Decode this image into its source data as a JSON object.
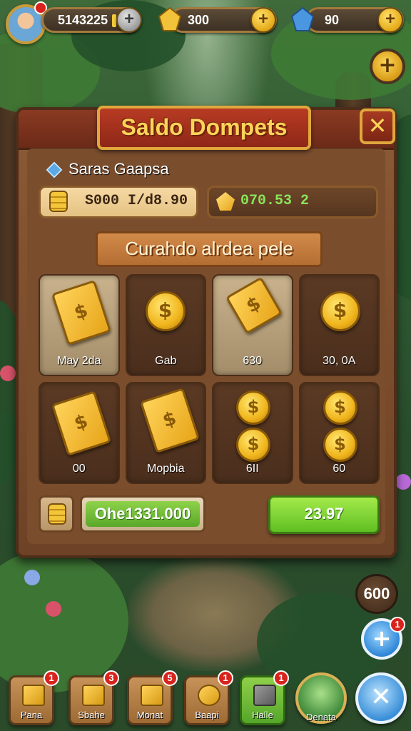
{
  "hud": {
    "player_currency": "5143225",
    "gold_gems": "300",
    "blue_gems": "90",
    "avatar_badge": "1"
  },
  "panel": {
    "title": "Saldo Dompets",
    "close_label": "✕",
    "section_title": "Saras Gaapsa",
    "coin_balance": "S000 I/d8.90",
    "gem_balance": "070.53 2",
    "sub_title": "Curahdo alrdea pele",
    "items": [
      {
        "label": "May 2da",
        "icon": "bill-icon"
      },
      {
        "label": "Gab",
        "icon": "coin-icon"
      },
      {
        "label": "630",
        "icon": "bill-icon"
      },
      {
        "label": "30, 0A",
        "icon": "coin-icon"
      },
      {
        "label": "00",
        "icon": "bill-icon"
      },
      {
        "label": "Mopbia",
        "icon": "bill-icon"
      },
      {
        "label": "6II",
        "icon": "coins-icon"
      },
      {
        "label": "60",
        "icon": "coins-icon"
      }
    ],
    "total": "Ohe1331.000",
    "buy_label": "23.97"
  },
  "side": {
    "counter": "600",
    "plus_badge": "1"
  },
  "nav": {
    "items": [
      {
        "label": "Pana",
        "badge": "1"
      },
      {
        "label": "Sbahe",
        "badge": "3"
      },
      {
        "label": "Monat",
        "badge": "5"
      },
      {
        "label": "Baapi",
        "badge": "1"
      },
      {
        "label": "Halle",
        "badge": "1"
      },
      {
        "label": "Denata"
      }
    ]
  },
  "colors": {
    "accent_gold": "#f0b51c",
    "panel_brown": "#7a4d2d",
    "title_red": "#b83b23",
    "buy_green": "#5fbf22"
  }
}
